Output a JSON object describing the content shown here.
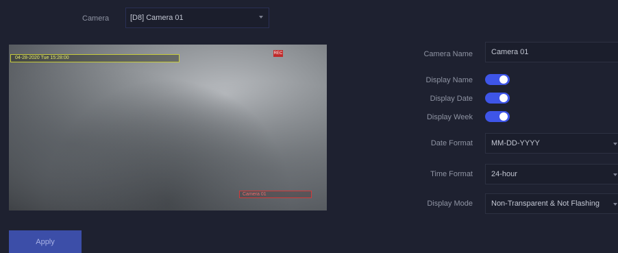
{
  "camera_selector": {
    "label": "Camera",
    "value": "[D8] Camera 01"
  },
  "preview": {
    "osd_datetime": "04-28-2020 Tue 15:28:00",
    "osd_marker": "REC",
    "osd_camera_name": "Camera 01"
  },
  "settings": {
    "camera_name": {
      "label": "Camera Name",
      "value": "Camera 01"
    },
    "display_name": {
      "label": "Display Name",
      "enabled": true
    },
    "display_date": {
      "label": "Display Date",
      "enabled": true
    },
    "display_week": {
      "label": "Display Week",
      "enabled": true
    },
    "date_format": {
      "label": "Date Format",
      "value": "MM-DD-YYYY"
    },
    "time_format": {
      "label": "Time Format",
      "value": "24-hour"
    },
    "display_mode": {
      "label": "Display Mode",
      "value": "Non-Transparent & Not Flashing"
    }
  },
  "apply_label": "Apply",
  "colors": {
    "toggle_on": "#3e55e8",
    "osd_datetime": "#c8cc3a",
    "osd_name": "#d23b3b",
    "apply_button": "#3c4ea8"
  }
}
